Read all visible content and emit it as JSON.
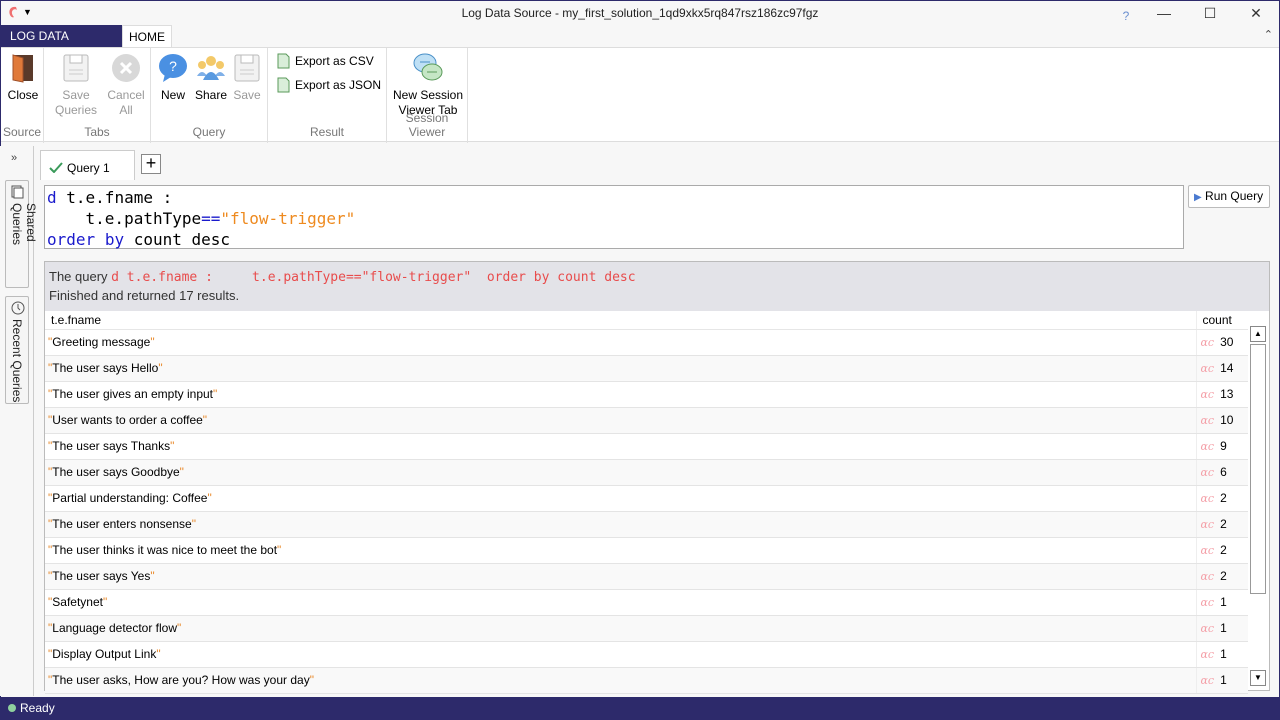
{
  "window": {
    "title": "Log Data Source - my_first_solution_1qd9xkx5rq847rsz186zc97fgz",
    "help": "?",
    "minimize": "—",
    "maximize": "☐",
    "close": "✕",
    "qa_arrow": "▼",
    "collapse": "⌃"
  },
  "ribbon_tabs": {
    "file": "LOG DATA SOURCE",
    "home": "HOME"
  },
  "ribbon": {
    "close": "Close",
    "save_queries": [
      "Save",
      "Queries"
    ],
    "cancel_all": [
      "Cancel",
      "All"
    ],
    "new": "New",
    "share": "Share",
    "save": "Save",
    "export_csv": "Export as CSV",
    "export_json": "Export as JSON",
    "new_session": [
      "New Session",
      "Viewer Tab"
    ],
    "groups": {
      "source": "Source",
      "tabs": "Tabs",
      "query": "Query",
      "result": "Result",
      "session_viewer": "Session Viewer"
    }
  },
  "side": {
    "expand": "»",
    "shared": "Shared Queries",
    "recent": "Recent Queries"
  },
  "query_tab": {
    "label": "Query 1",
    "add": "+"
  },
  "editor": {
    "line1_kw": "d",
    "line1_rest": " t.e.fname :",
    "line2_pre": "    t.e.pathType",
    "line2_op": "==",
    "line2_str": "\"flow-trigger\"",
    "line3_kw1": "order",
    "line3_sp": " ",
    "line3_kw2": "by",
    "line3_rest": " count desc"
  },
  "run_query": "Run Query",
  "result": {
    "prefix": "The query ",
    "query": "d t.e.fname :     t.e.pathType==\"flow-trigger\"  order by count desc",
    "summary": "Finished and returned 17 results.",
    "columns": [
      "t.e.fname",
      "count"
    ],
    "rows": [
      [
        "Greeting message",
        "30"
      ],
      [
        "The user says Hello",
        "14"
      ],
      [
        "The user gives an empty input",
        "13"
      ],
      [
        "User wants to order a coffee",
        "10"
      ],
      [
        "The user says Thanks",
        "9"
      ],
      [
        "The user says Goodbye",
        "6"
      ],
      [
        "Partial understanding: Coffee",
        "2"
      ],
      [
        "The user enters nonsense",
        "2"
      ],
      [
        "The user thinks it was nice to meet the bot",
        "2"
      ],
      [
        "The user says Yes",
        "2"
      ],
      [
        "Safetynet",
        "1"
      ],
      [
        "Language detector flow",
        "1"
      ],
      [
        "Display Output Link",
        "1"
      ],
      [
        "The user asks, How are you? How was your day",
        "1"
      ]
    ]
  },
  "status": "Ready"
}
